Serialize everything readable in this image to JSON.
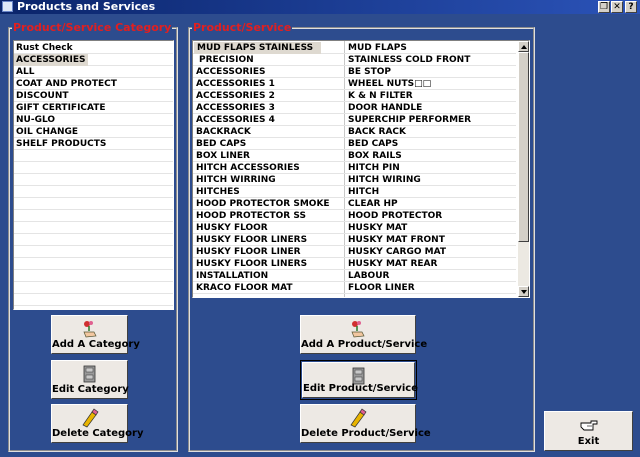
{
  "window": {
    "title": "Products and Services"
  },
  "category_panel": {
    "legend": "Product/Service Category",
    "items": [
      "Rust Check",
      "ACCESSORIES",
      "ALL",
      "COAT AND PROTECT",
      "DISCOUNT",
      "GIFT CERTIFICATE",
      "NU-GLO",
      "OIL CHANGE",
      "SHELF PRODUCTS"
    ],
    "selected": "ACCESSORIES"
  },
  "product_panel": {
    "legend": "Product/Service",
    "col1": [
      "MUD  FLAPS STAINLESS",
      "PRECISION",
      "ACCESSORIES",
      "ACCESSORIES 1",
      "ACCESSORIES 2",
      "ACCESSORIES 3",
      "ACCESSORIES 4",
      "BACKRACK",
      "BED CAPS",
      "BOX LINER",
      "HITCH ACCESSORIES",
      "HITCH WIRRING",
      "HITCHES",
      "HOOD  PROTECTOR SMOKE",
      "HOOD PROTECTOR SS",
      "HUSKY FLOOR",
      "HUSKY FLOOR  LINERS",
      "HUSKY FLOOR LINER",
      "HUSKY FLOOR LINERS",
      "INSTALLATION",
      "KRACO FLOOR MAT"
    ],
    "col2": [
      "MUD FLAPS",
      "STAINLESS COLD FRONT",
      "BE STOP",
      "WHEEL NUTS□□",
      "K & N FILTER",
      "DOOR HANDLE",
      "SUPERCHIP PERFORMER",
      "BACK RACK",
      "BED CAPS",
      "BOX RAILS",
      "HITCH PIN",
      "HITCH WIRING",
      "HITCH",
      "CLEAR HP",
      "HOOD PROTECTOR",
      "HUSKY MAT",
      "HUSKY MAT FRONT",
      "HUSKY CARGO MAT",
      "HUSKY MAT REAR",
      "LABOUR",
      "FLOOR LINER"
    ],
    "selected": "MUD  FLAPS STAINLESS"
  },
  "buttons": {
    "add_category": "Add A Category",
    "edit_category": "Edit Category",
    "delete_category": "Delete Category",
    "add_product": "Add A Product/Service",
    "edit_product": "Edit Product/Service",
    "delete_product": "Delete Product/Service",
    "exit": "Exit"
  },
  "icons": {
    "window": "app-icon",
    "add": "hand-with-flower-icon",
    "edit": "file-cabinet-icon",
    "delete": "pencil-eraser-icon",
    "exit": "pointing-hand-icon"
  },
  "colors": {
    "background": "#2d4c8e",
    "legend": "#e21f1f",
    "button_face": "#ede9e4",
    "selection": "#ded9d0"
  }
}
